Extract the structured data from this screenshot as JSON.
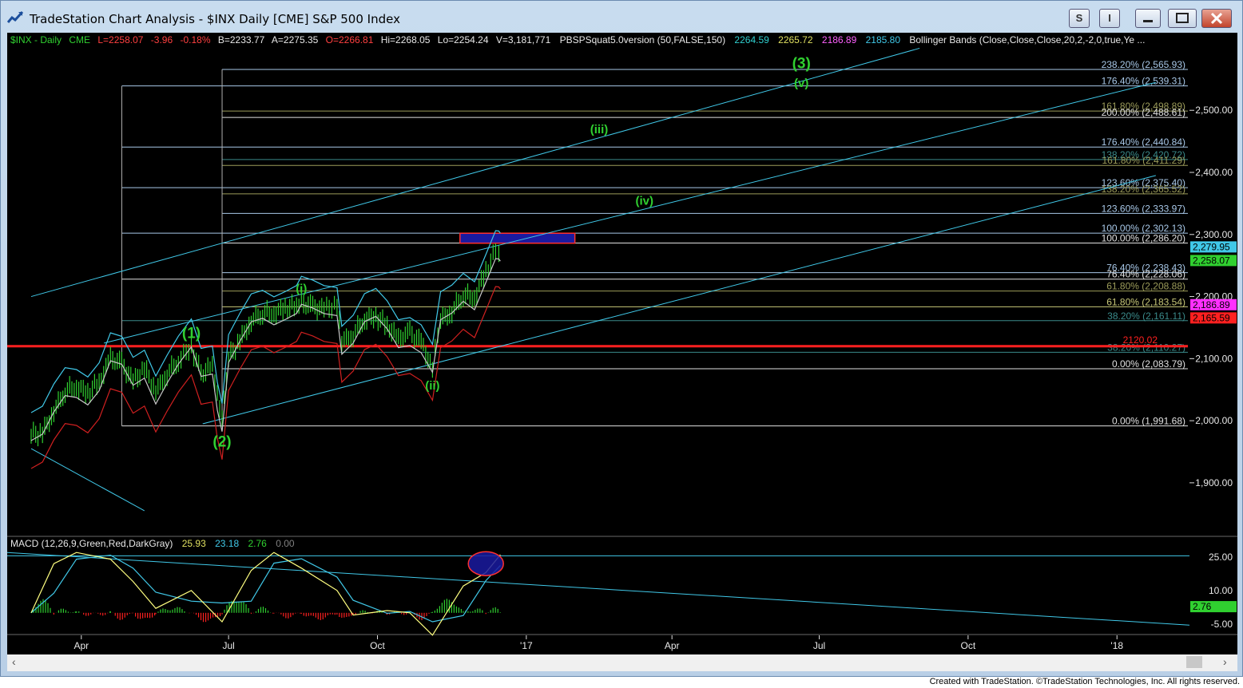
{
  "window": {
    "title": "TradeStation Chart Analysis - $INX Daily [CME] S&P 500 Index",
    "buttons": {
      "s_label": "S",
      "i_label": "I"
    }
  },
  "header": {
    "symbol": "$INX - Daily",
    "exchange": "CME",
    "last": "L=2258.07",
    "change": "-3.96",
    "change_pct": "-0.18%",
    "bid": "B=2233.77",
    "ask": "A=2275.35",
    "open": "O=2266.81",
    "high": "Hi=2268.05",
    "low": "Lo=2254.24",
    "volume": "V=3,181,771",
    "study": "PBSPSquat5.0version (50,FALSE,150)",
    "study_vals": [
      "2264.59",
      "2265.72",
      "2186.89",
      "2185.80"
    ],
    "bb": "Bollinger Bands (Close,Close,Close,20,2,-2,0,true,Ye ..."
  },
  "macd_header": {
    "label": "MACD (12,26,9,Green,Red,DarkGray)",
    "vals": [
      "25.93",
      "23.18",
      "2.76",
      "0.00"
    ]
  },
  "fib_levels": [
    {
      "label": "238.20% (2,565.93)",
      "price": 2565.93,
      "color": "#a8c8e8"
    },
    {
      "label": "176.40% (2,539.31)",
      "price": 2539.31,
      "color": "#a8c8e8"
    },
    {
      "label": "161.80% (2,498.89)",
      "price": 2498.89,
      "color": "#9c9c5a"
    },
    {
      "label": "200.00% (2,488.61)",
      "price": 2488.61,
      "color": "#e0e0e0"
    },
    {
      "label": "176.40% (2,440.84)",
      "price": 2440.84,
      "color": "#a8c8e8"
    },
    {
      "label": "138.20% (2,420.72)",
      "price": 2420.72,
      "color": "#3a8a8a"
    },
    {
      "label": "161.80% (2,411.29)",
      "price": 2411.29,
      "color": "#9c9c5a"
    },
    {
      "label": "123.60% (2,375.40)",
      "price": 2375.4,
      "color": "#a8c8e8"
    },
    {
      "label": "138.20% (2,365.52)",
      "price": 2365.52,
      "color": "#9c9c5a"
    },
    {
      "label": "123.60% (2,333.97)",
      "price": 2333.97,
      "color": "#a8c8e8"
    },
    {
      "label": "100.00% (2,302.13)",
      "price": 2302.13,
      "color": "#a8c8e8"
    },
    {
      "label": "100.00% (2,286.20)",
      "price": 2286.2,
      "color": "#e0e0e0"
    },
    {
      "label": "76.40% (2,238.43)",
      "price": 2238.43,
      "color": "#a8c8e8"
    },
    {
      "label": "76.40% (2,228.06)",
      "price": 2228.06,
      "color": "#e0e0e0"
    },
    {
      "label": "61.80% (2,208.88)",
      "price": 2208.88,
      "color": "#9c9c5a"
    },
    {
      "label": "61.80% (2,183.54)",
      "price": 2183.54,
      "color": "#c8c878"
    },
    {
      "label": "38.20% (2,161.11)",
      "price": 2161.11,
      "color": "#3a8a8a"
    },
    {
      "label": "38.20% (2,110.27)",
      "price": 2110.27,
      "color": "#3a8a8a"
    },
    {
      "label": "0.00% (2,083.79)",
      "price": 2083.79,
      "color": "#e0e0e0"
    },
    {
      "label": "0.00% (1,991.68)",
      "price": 1991.68,
      "color": "#e0e0e0"
    }
  ],
  "support_line": {
    "label": "2120.02",
    "price": 2120.02,
    "color": "#ff2020"
  },
  "price_badges": [
    {
      "label": "2,279.95",
      "price": 2279.95,
      "bg": "#40c8e8",
      "fg": "#000"
    },
    {
      "label": "2,258.07",
      "price": 2258.07,
      "bg": "#30d030",
      "fg": "#000"
    },
    {
      "label": "2,186.89",
      "price": 2186.89,
      "bg": "#ff30ff",
      "fg": "#000"
    },
    {
      "label": "2,165.59",
      "price": 2165.59,
      "bg": "#ff2020",
      "fg": "#000"
    }
  ],
  "macd_badge": {
    "label": "2.76",
    "value": 2.76,
    "bg": "#30d030"
  },
  "wave_labels": [
    {
      "text": "(1)",
      "date": "2016-06-08",
      "price": 2120.55,
      "size": "big"
    },
    {
      "text": "(2)",
      "date": "2016-06-27",
      "price": 1991.68,
      "size": "big",
      "below": true
    },
    {
      "text": "(i)",
      "date": "2016-08-15",
      "price": 2193.81,
      "size": "small"
    },
    {
      "text": "(ii)",
      "date": "2016-11-04",
      "price": 2083.79,
      "size": "small",
      "below": true
    },
    {
      "text": "(iii)",
      "date": "2017-02-15",
      "price": 2450,
      "size": "small"
    },
    {
      "text": "(iv)",
      "date": "2017-03-15",
      "price": 2335,
      "size": "small"
    },
    {
      "text": "(3)",
      "date": "2017-06-20",
      "price": 2555,
      "size": "big"
    },
    {
      "text": "(v)",
      "date": "2017-06-20",
      "price": 2525,
      "size": "small"
    }
  ],
  "target_box": {
    "price_top": 2302,
    "price_bottom": 2286,
    "start": "2016-11-21",
    "end": "2017-01-31"
  },
  "colors": {
    "bars": "#30d030",
    "text_green": "#30d030",
    "cyan": "#40c8e8",
    "red": "#ff2020",
    "macd_pos": "#30d030",
    "macd_neg": "#ff2020",
    "macd_line": "#ffff80",
    "signal_line": "#40c8e8",
    "wave_green": "#30d030"
  },
  "chart_data": [
    {
      "type": "candlestick",
      "title": "$INX Daily [CME] S&P 500 Index",
      "xlabel": "",
      "ylabel": "",
      "ylim": [
        1815,
        2625
      ],
      "xlim": [
        "2016-03-01",
        "2018-01-31"
      ],
      "x_tick_labels": [
        "Apr",
        "Jul",
        "Oct",
        "'17",
        "Apr",
        "Jul",
        "Oct",
        "'18"
      ],
      "x_tick_dates": [
        "2016-04-01",
        "2016-07-01",
        "2016-10-01",
        "2017-01-01",
        "2017-04-01",
        "2017-07-01",
        "2017-10-01",
        "2018-01-01"
      ],
      "y_ticks": [
        1900,
        2000,
        2100,
        2200,
        2300,
        2400,
        2500
      ],
      "y_tick_labels": [
        "1,900.00",
        "2,000.00",
        "2,100.00",
        "2,200.00",
        "2,300.00",
        "2,400.00",
        "2,500.00"
      ],
      "series": [
        {
          "name": "$INX - Daily",
          "points": [
            [
              "2016-03-01",
              1978
            ],
            [
              "2016-03-08",
              1980
            ],
            [
              "2016-03-15",
              2015
            ],
            [
              "2016-03-22",
              2049
            ],
            [
              "2016-03-29",
              2055
            ],
            [
              "2016-04-05",
              2045
            ],
            [
              "2016-04-12",
              2061
            ],
            [
              "2016-04-19",
              2100
            ],
            [
              "2016-04-26",
              2091
            ],
            [
              "2016-05-03",
              2063
            ],
            [
              "2016-05-10",
              2084
            ],
            [
              "2016-05-17",
              2047
            ],
            [
              "2016-05-24",
              2076
            ],
            [
              "2016-05-31",
              2097
            ],
            [
              "2016-06-08",
              2119
            ],
            [
              "2016-06-14",
              2075
            ],
            [
              "2016-06-21",
              2088
            ],
            [
              "2016-06-24",
              2037
            ],
            [
              "2016-06-27",
              2000
            ],
            [
              "2016-07-01",
              2102
            ],
            [
              "2016-07-08",
              2129
            ],
            [
              "2016-07-15",
              2161
            ],
            [
              "2016-07-22",
              2175
            ],
            [
              "2016-07-29",
              2173
            ],
            [
              "2016-08-05",
              2182
            ],
            [
              "2016-08-12",
              2184
            ],
            [
              "2016-08-15",
              2190
            ],
            [
              "2016-08-22",
              2182
            ],
            [
              "2016-08-29",
              2180
            ],
            [
              "2016-09-06",
              2186
            ],
            [
              "2016-09-09",
              2127
            ],
            [
              "2016-09-16",
              2139
            ],
            [
              "2016-09-23",
              2164
            ],
            [
              "2016-09-30",
              2168
            ],
            [
              "2016-10-07",
              2153
            ],
            [
              "2016-10-14",
              2132
            ],
            [
              "2016-10-21",
              2141
            ],
            [
              "2016-10-28",
              2126
            ],
            [
              "2016-11-04",
              2085
            ],
            [
              "2016-11-09",
              2163
            ],
            [
              "2016-11-16",
              2176
            ],
            [
              "2016-11-23",
              2204
            ],
            [
              "2016-11-30",
              2198
            ],
            [
              "2016-12-07",
              2241
            ],
            [
              "2016-12-13",
              2271
            ],
            [
              "2016-12-15",
              2262
            ],
            [
              "2016-12-16",
              2258
            ]
          ]
        },
        {
          "name": "Bollinger Bands",
          "points": []
        }
      ]
    },
    {
      "type": "line",
      "title": "MACD (12,26,9,Green,Red,DarkGray)",
      "ylim": [
        -9,
        31
      ],
      "y_ticks": [
        -5,
        10,
        25
      ],
      "y_tick_labels": [
        "-5.00",
        "10.00",
        "25.00"
      ],
      "series": [
        {
          "name": "MACD",
          "points": [
            [
              "2016-03-01",
              0
            ],
            [
              "2016-03-15",
              22
            ],
            [
              "2016-03-29",
              27
            ],
            [
              "2016-04-19",
              24
            ],
            [
              "2016-05-03",
              14
            ],
            [
              "2016-05-17",
              2
            ],
            [
              "2016-06-08",
              10
            ],
            [
              "2016-06-27",
              -4
            ],
            [
              "2016-07-15",
              19
            ],
            [
              "2016-07-29",
              27
            ],
            [
              "2016-08-15",
              20
            ],
            [
              "2016-09-06",
              10
            ],
            [
              "2016-09-16",
              -1
            ],
            [
              "2016-10-07",
              1
            ],
            [
              "2016-10-21",
              0
            ],
            [
              "2016-11-04",
              -10
            ],
            [
              "2016-11-23",
              12
            ],
            [
              "2016-12-07",
              18
            ],
            [
              "2016-12-16",
              26
            ]
          ]
        }
      ]
    }
  ]
}
